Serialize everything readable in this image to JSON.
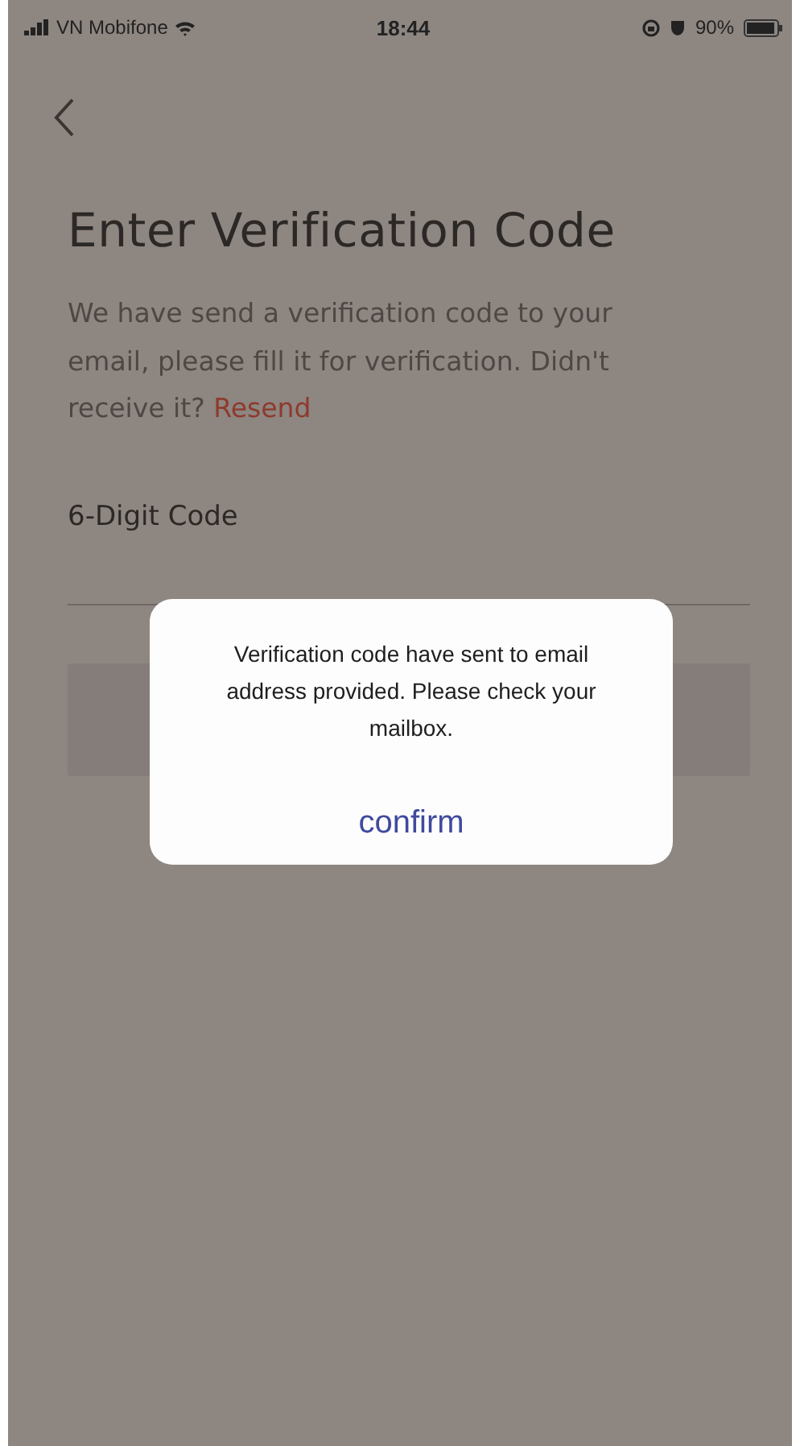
{
  "status_bar": {
    "carrier": "VN Mobifone",
    "time": "18:44",
    "battery": "90%"
  },
  "title": "Enter Verification Code",
  "description": {
    "text": "We have send a verification code to your email, please fill it for verification. Didn't receive it?",
    "link": "Resend"
  },
  "code_field": {
    "label": "6-Digit Code"
  },
  "submit_button": {
    "disabled": true
  },
  "dialog": {
    "message": "Verification code have sent to email address provided. Please check your mailbox.",
    "button": "confirm"
  }
}
